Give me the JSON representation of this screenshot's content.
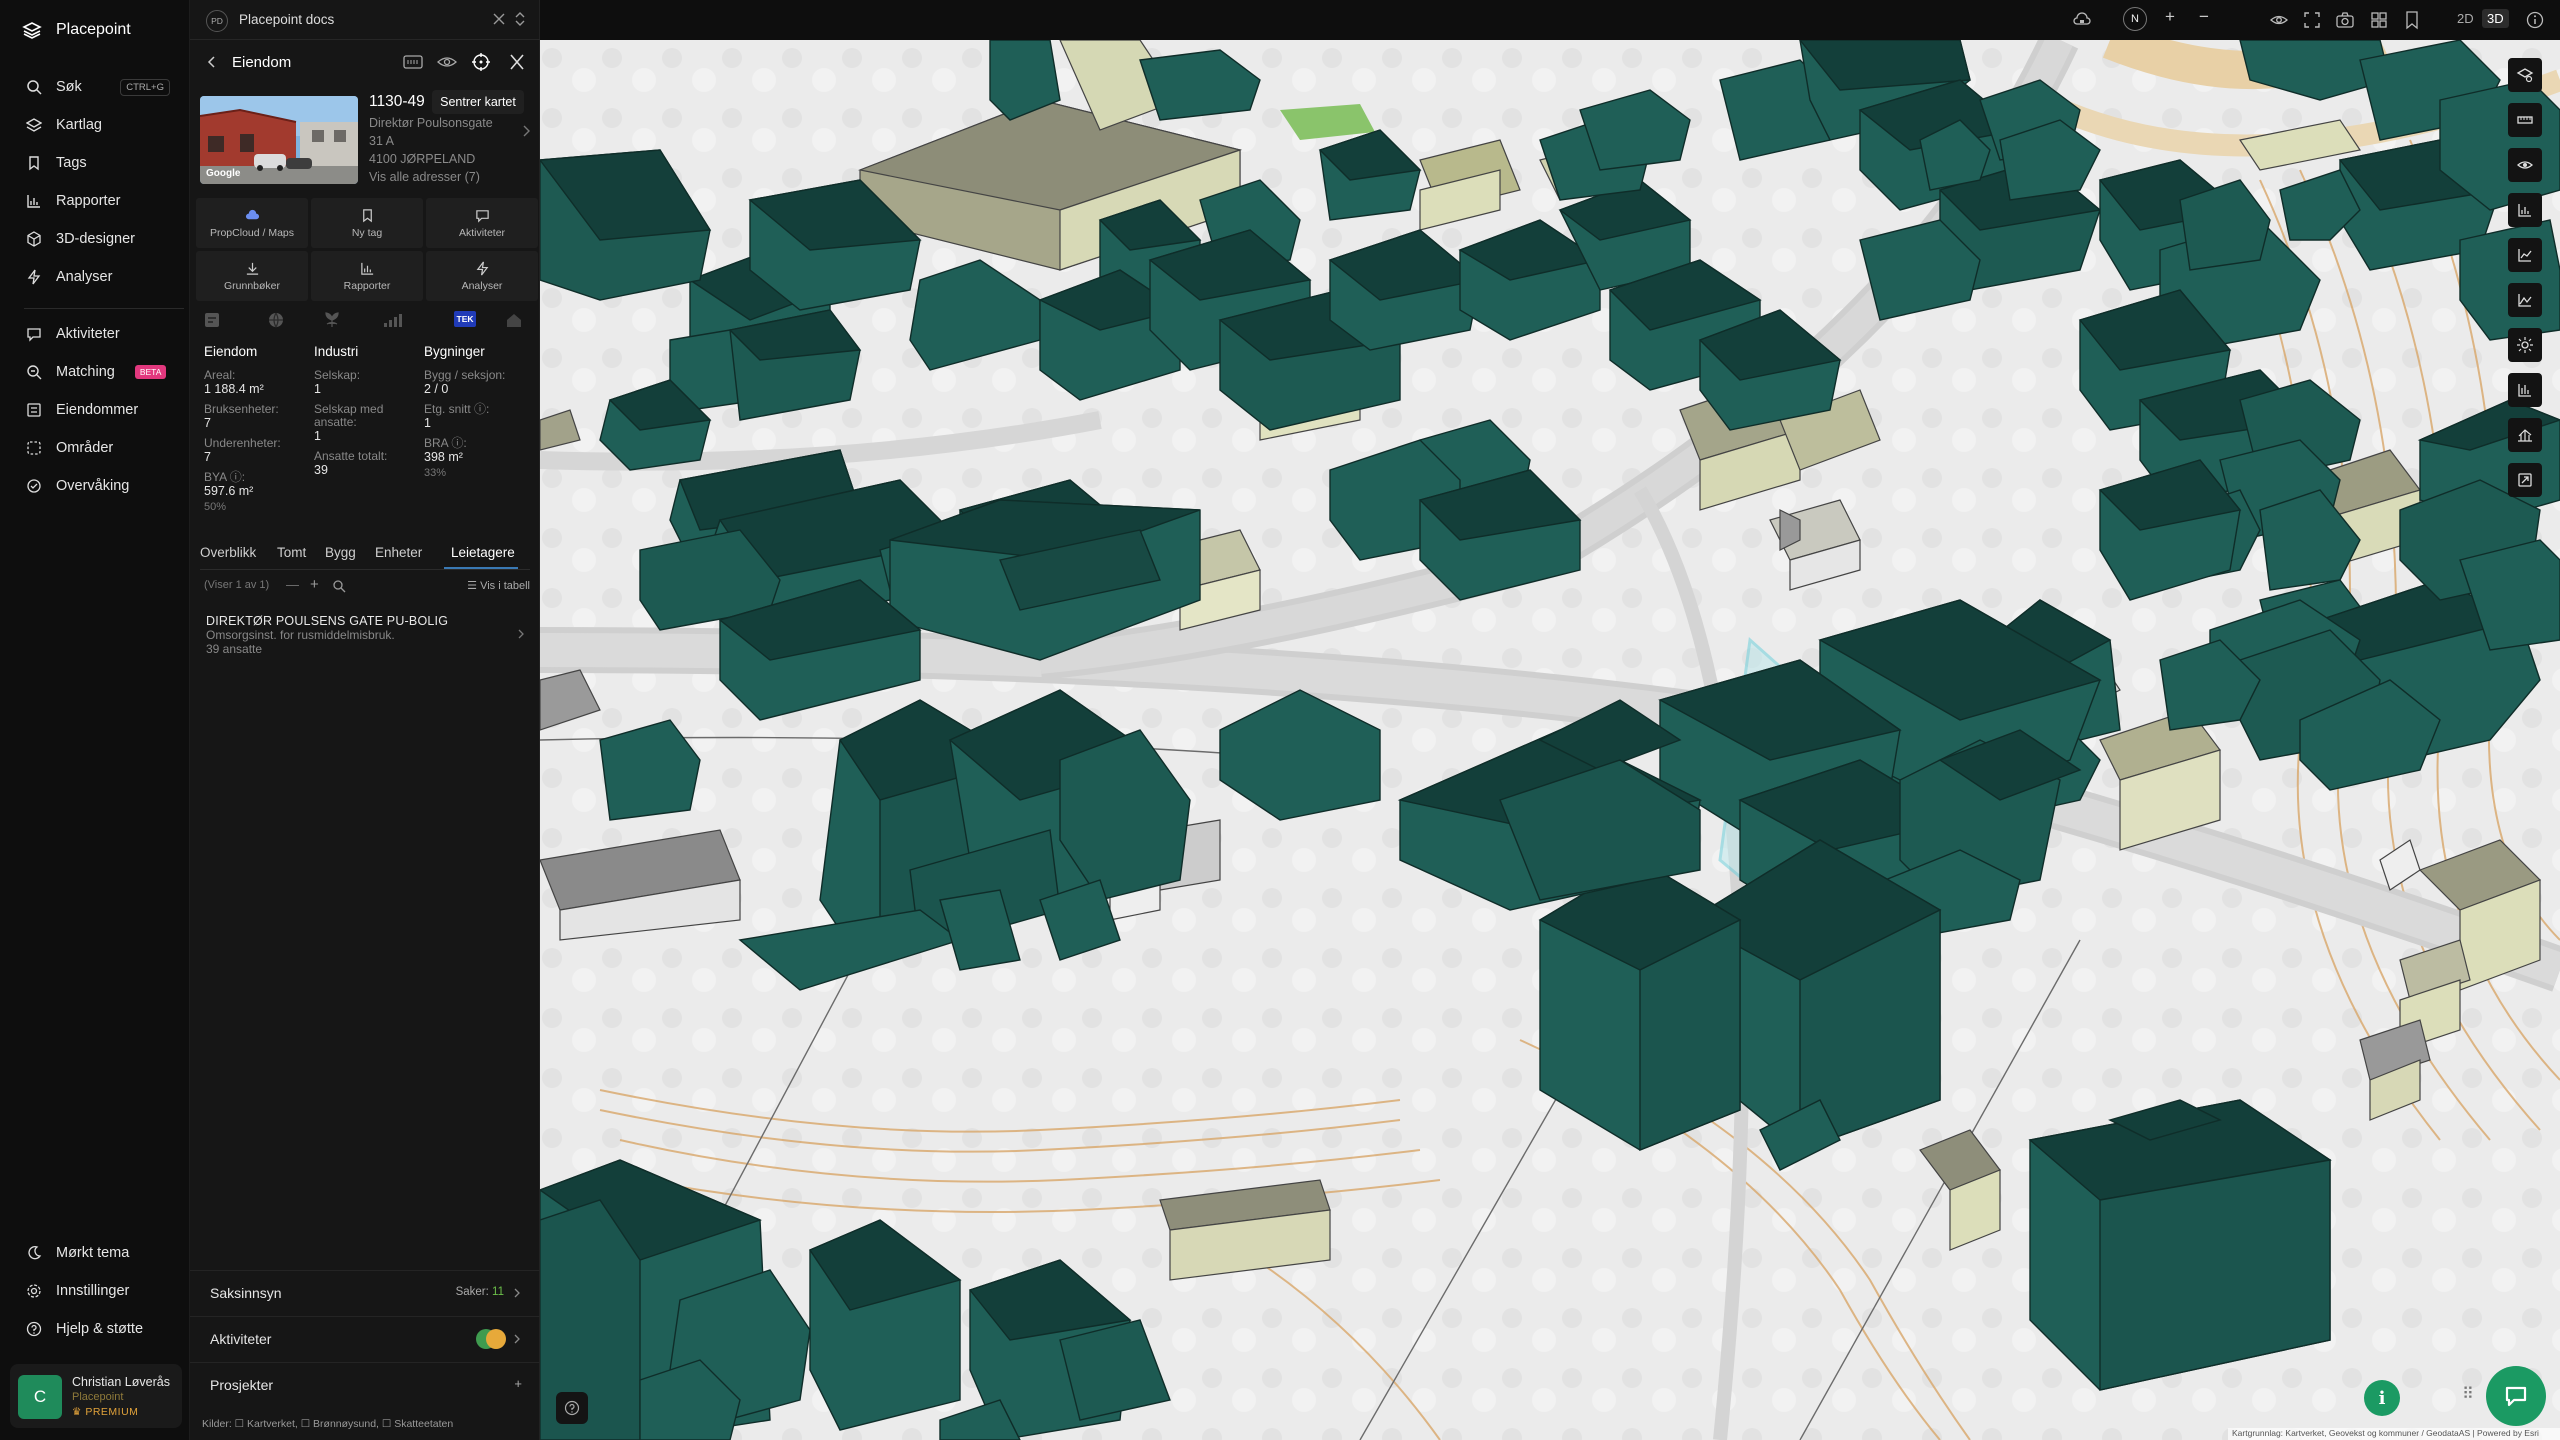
{
  "app": {
    "brand": "Placepoint"
  },
  "nav": {
    "items": [
      {
        "label": "Søk",
        "shortcut": "CTRL+G"
      },
      {
        "label": "Kartlag"
      },
      {
        "label": "Tags"
      },
      {
        "label": "Rapporter"
      },
      {
        "label": "3D-designer"
      },
      {
        "label": "Analyser"
      }
    ],
    "items2": [
      {
        "label": "Aktiviteter"
      },
      {
        "label": "Matching",
        "badge": "BETA"
      },
      {
        "label": "Eiendommer"
      },
      {
        "label": "Områder"
      },
      {
        "label": "Overvåking"
      }
    ],
    "bottom": [
      {
        "label": "Mørkt tema"
      },
      {
        "label": "Innstillinger"
      },
      {
        "label": "Hjelp & støtte"
      }
    ],
    "user": {
      "initial": "C",
      "name": "Christian Løverås",
      "org": "Placepoint",
      "plan": "PREMIUM"
    }
  },
  "panel": {
    "workspace_logo": "PD",
    "workspace": "Placepoint docs",
    "title": "Eiendom",
    "tooltip": "Sentrer kartet",
    "photo_credit": "Google",
    "property_id": "1130-49",
    "address": [
      "Direktør Poulsonsgate",
      "31 A",
      "4100 JØRPELAND",
      "Vis alle adresser (7)"
    ],
    "actions": [
      {
        "label": "PropCloud / Maps"
      },
      {
        "label": "Ny tag"
      },
      {
        "label": "Aktiviteter"
      },
      {
        "label": "Grunnbøker"
      },
      {
        "label": "Rapporter"
      },
      {
        "label": "Analyser"
      }
    ],
    "source_badge": "TEK",
    "columns": {
      "eiendom": {
        "heading": "Eiendom",
        "areal_label": "Areal:",
        "areal": "1 188.4 m²",
        "bruks_label": "Bruksenheter:",
        "bruks": "7",
        "under_label": "Underenheter:",
        "under": "7",
        "bya_label": "BYA ⓘ:",
        "bya": "597.6 m²",
        "bya_pct": "50%"
      },
      "industri": {
        "heading": "Industri",
        "selskap_label": "Selskap:",
        "selskap": "1",
        "ansatte_label": "Selskap med ansatte:",
        "ansatte": "1",
        "total_label": "Ansatte totalt:",
        "total": "39"
      },
      "bygninger": {
        "heading": "Bygninger",
        "bygg_label": "Bygg / seksjon:",
        "bygg": "2 / 0",
        "etg_label": "Etg. snitt ⓘ:",
        "etg": "1",
        "bra_label": "BRA ⓘ:",
        "bra": "398 m²",
        "bra_pct": "33%"
      }
    },
    "tabs": [
      "Overblikk",
      "Tomt",
      "Bygg",
      "Enheter",
      "Leietagere"
    ],
    "list_info": "(Viser 1 av 1)",
    "list_table": "Vis i tabell",
    "tenant": {
      "name": "DIREKTØR POULSENS GATE PU-BOLIG",
      "desc": "Omsorgsinst. for rusmiddelmisbruk.",
      "employees": "39 ansatte"
    },
    "rows": [
      {
        "label": "Saksinnsyn",
        "right": "Saker:",
        "count": "11"
      },
      {
        "label": "Aktiviteter"
      },
      {
        "label": "Prosjekter",
        "right": "+"
      }
    ],
    "sources": "Kilder: ☐ Kartverket, ☐ Brønnøysund, ☐ Skatteetaten"
  },
  "toolbar": {
    "mode2d": "2D",
    "mode3d": "3D",
    "north": "N"
  },
  "map": {
    "attribution": "Kartgrunnlag: Kartverket, Geovekst og kommuner / GeodataAS | Powered by Esri",
    "colors": {
      "building": "#1f5f57",
      "building_dark": "#133f3a",
      "ground": "#ececec",
      "road": "#cfcfcf",
      "accent_parcel": "#7fd3dd"
    }
  }
}
